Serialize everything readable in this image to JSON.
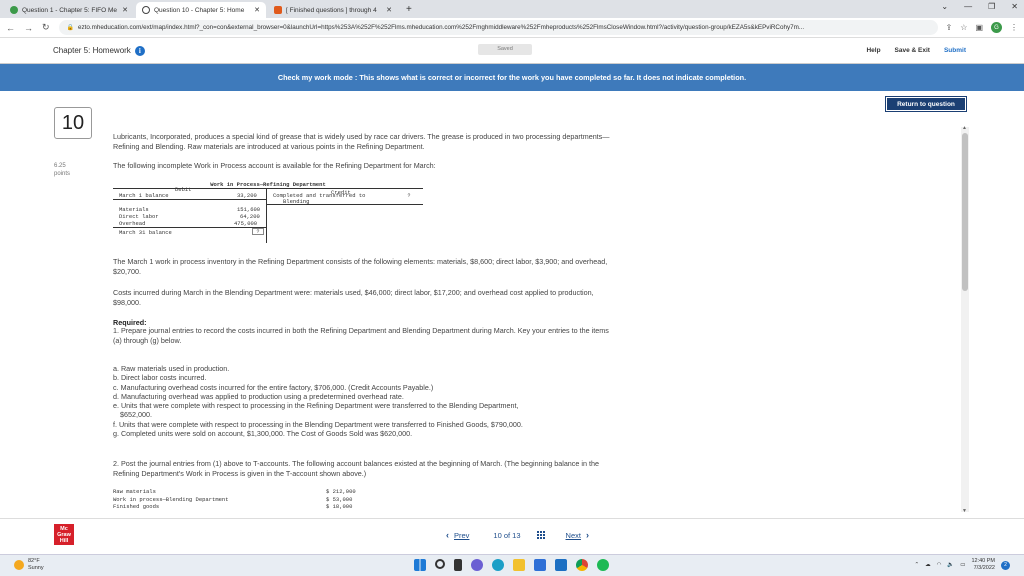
{
  "browser": {
    "tabs": [
      {
        "label": "Question 1 - Chapter 5: FIFO Me",
        "active": false,
        "icon_color": "#3c9a4a"
      },
      {
        "label": "Question 10 - Chapter 5: Home",
        "active": true,
        "icon_color": "#444444"
      },
      {
        "label": "[ Finished questions ] through 4",
        "active": false,
        "icon_color": "#e05a1c"
      }
    ],
    "new_tab": "+",
    "url": "ezto.mheducation.com/ext/map/index.html?_con=con&external_browser=0&launchUrl=https%253A%252F%252Flms.mheducation.com%252Fmghmiddleware%252Fmheproducts%252FlmsCloseWindow.html?/activity/question-group/kEZA5s&kEPviRCohy7m...",
    "profile_letter": "G"
  },
  "header": {
    "chapter_title": "Chapter 5: Homework",
    "saved_label": "Saved",
    "help": "Help",
    "save_exit": "Save & Exit",
    "submit": "Submit"
  },
  "banner": {
    "text": "Check my work mode : This shows what is correct or incorrect for the work you have completed so far. It does not indicate completion."
  },
  "question": {
    "return_button": "Return to question",
    "number": "10",
    "points_value": "6.25",
    "points_label": "points",
    "intro": "Lubricants, Incorporated, produces a special kind of grease that is widely used by race car drivers. The grease is produced in two processing departments—Refining and Blending. Raw materials are introduced at various points in the Refining Department.",
    "incomplete_account": "The following incomplete Work in Process account is available for the Refining Department for March:",
    "t_account": {
      "title": "Work in Process—Refining Department",
      "debit_label": "Debit",
      "credit_label": "Credit",
      "debits": [
        {
          "label": "March 1 balance",
          "value": "33,200"
        },
        {
          "label": "Materials",
          "value": "151,600"
        },
        {
          "label": "Direct labor",
          "value": "64,200"
        },
        {
          "label": "Overhead",
          "value": "475,000"
        },
        {
          "label": "March 31 balance",
          "value": "?"
        }
      ],
      "credit_line1": "Completed and transferred to",
      "credit_line2": "Blending",
      "credit_value": "?"
    },
    "inventory_text": "The March 1 work in process inventory in the Refining Department consists of the following elements: materials, $8,600; direct labor, $3,900; and overhead, $20,700.",
    "costs_text": "Costs incurred during March in the Blending Department were: materials used, $46,000; direct labor, $17,200; and overhead cost applied to production, $98,000.",
    "required_label": "Required:",
    "req1": "1. Prepare journal entries to record the costs incurred in both the Refining Department and Blending Department during March. Key your entries to the items (a) through (g) below.",
    "items": [
      "a. Raw materials used in production.",
      "b. Direct labor costs incurred.",
      "c. Manufacturing overhead costs incurred for the entire factory, $706,000. (Credit Accounts Payable.)",
      "d. Manufacturing overhead was applied to production using a predetermined overhead rate.",
      "e. Units that were complete with respect to processing in the Refining Department were transferred to the Blending Department,",
      "$652,000.",
      "f. Units that were complete with respect to processing in the Blending Department were transferred to Finished Goods, $790,000.",
      "g. Completed units were sold on account, $1,300,000. The Cost of Goods Sold was $620,000."
    ],
    "req2": "2. Post the journal entries from (1) above to T-accounts. The following account balances existed at the beginning of March. (The beginning balance in the Refining Department's Work in Process is given in the T-account shown above.)",
    "balances": [
      {
        "label": "Raw materials",
        "value": "$ 212,000"
      },
      {
        "label": "Work in process—Blending Department",
        "value": "$ 53,000"
      },
      {
        "label": "Finished goods",
        "value": "$ 18,000"
      }
    ]
  },
  "footer": {
    "logo_text": "Mc Graw Hill",
    "prev": "Prev",
    "position": "10 of 13",
    "next": "Next"
  },
  "taskbar": {
    "temp": "82°F",
    "condition": "Sunny",
    "time": "12:40 PM",
    "date": "7/3/2022",
    "notifications": "2"
  }
}
